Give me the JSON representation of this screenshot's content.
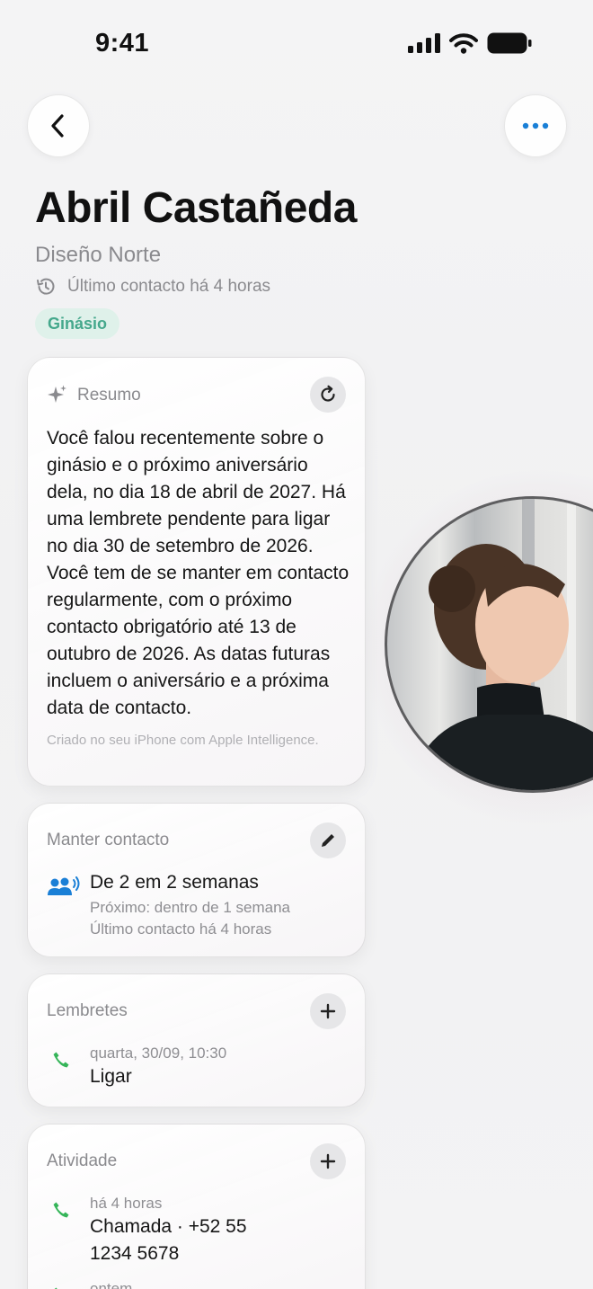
{
  "status_bar": {
    "time": "9:41"
  },
  "contact": {
    "name": "Abril Castañeda",
    "company": "Diseño Norte",
    "last_contact": "Último contacto há 4 horas",
    "tag": "Ginásio"
  },
  "summary": {
    "title": "Resumo",
    "text": "Você falou recentemente sobre o ginásio e o próximo aniversário dela, no dia 18 de abril de 2027. Há uma lembrete pendente para ligar no dia 30 de setembro de 2026. Você tem de se manter em contacto regularmente, com o próximo contacto obrigatório até 13 de outubro de 2026. As datas futuras incluem o aniversário e a próxima data de contacto.",
    "footer": "Criado no seu iPhone com Apple Intelligence."
  },
  "keep_in_touch": {
    "title": "Manter contacto",
    "frequency": "De 2 em 2 semanas",
    "next": "Próximo: dentro de 1 semana",
    "last": "Último contacto há 4 horas"
  },
  "reminders": {
    "title": "Lembretes",
    "items": [
      {
        "when": "quarta, 30/09, 10:30",
        "label": "Ligar"
      }
    ]
  },
  "activity": {
    "title": "Atividade",
    "items": [
      {
        "when": "há 4 horas",
        "label_line1": "Chamada · +52 55",
        "label_line2": "1234 5678"
      },
      {
        "when": "ontem"
      }
    ]
  },
  "colors": {
    "accent": "#1a7fd6",
    "tag_bg": "#dff1ea",
    "tag_text": "#45a88c",
    "phone_green": "#35b559"
  }
}
